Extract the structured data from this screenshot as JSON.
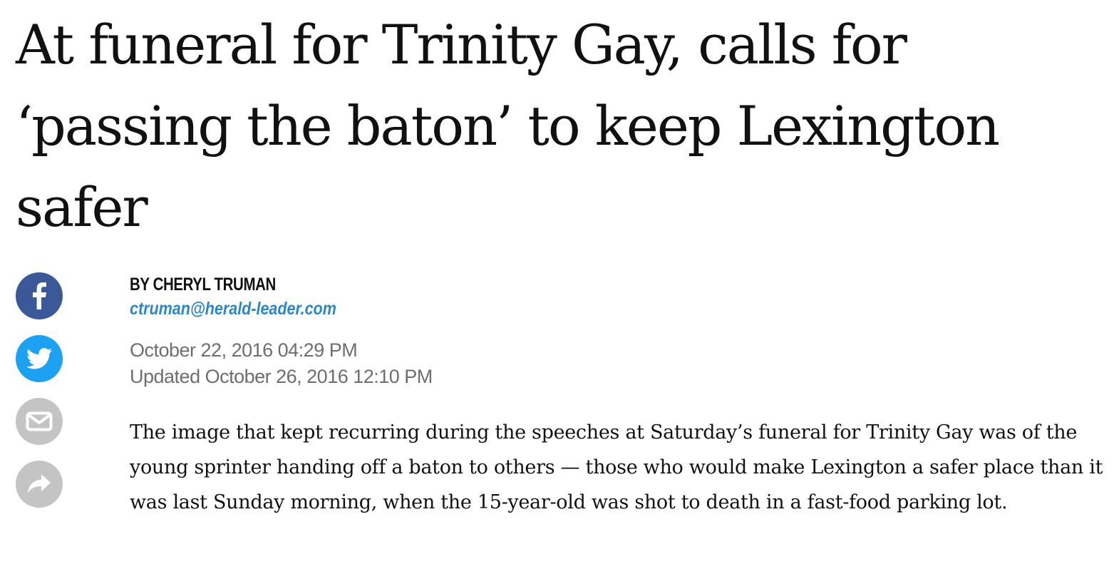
{
  "article": {
    "headline": "At funeral for Trinity Gay, calls for ‘passing the baton’ to keep Lexington safer",
    "byline": "BY CHERYL TRUMAN",
    "author_email": "ctruman@herald-leader.com",
    "published": "October 22, 2016 04:29 PM",
    "updated": "Updated October 26, 2016 12:10 PM",
    "body_paragraph": "The image that kept recurring during the speeches at Saturday’s funeral for Trinity Gay was of the young sprinter handing off a baton to others — those who would make Lexington a safer place than it was last Sunday morning, when the 15-year-old was shot to death in a fast-food parking lot."
  },
  "share_bar": {
    "buttons": [
      {
        "icon": "facebook-icon",
        "color": "#3b5998"
      },
      {
        "icon": "twitter-icon",
        "color": "#1da1f2"
      },
      {
        "icon": "email-icon",
        "color": "#c4c4c4"
      },
      {
        "icon": "share-icon",
        "color": "#c4c4c4"
      }
    ]
  }
}
